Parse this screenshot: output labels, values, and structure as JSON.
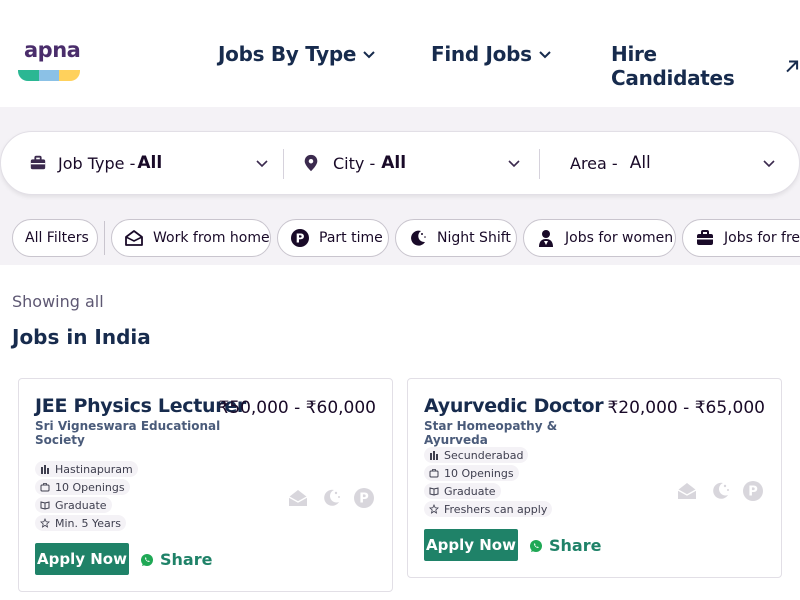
{
  "brand": {
    "name": "apna",
    "bar_colors": [
      "#2bb793",
      "#8bc1e6",
      "#ffd15c"
    ]
  },
  "nav": {
    "items": [
      {
        "label": "Jobs By Type",
        "icon": "chevron-down-icon"
      },
      {
        "label": "Find Jobs",
        "icon": "chevron-down-icon"
      },
      {
        "label": "Hire Candidates",
        "icon": "arrow-up-right-icon"
      }
    ]
  },
  "search": {
    "job_type": {
      "label": "Job Type -",
      "value": "All"
    },
    "city": {
      "label": "City -",
      "value": "All"
    },
    "area": {
      "label": "Area -",
      "value": "All"
    }
  },
  "filters": [
    {
      "label": "All Filters"
    },
    {
      "label": "Work from home",
      "icon": "home-icon"
    },
    {
      "label": "Part time",
      "icon": "part-time-icon"
    },
    {
      "label": "Night Shift",
      "icon": "moon-icon"
    },
    {
      "label": "Jobs for women",
      "icon": "woman-icon"
    },
    {
      "label": "Jobs for freshers",
      "icon": "briefcase-icon"
    }
  ],
  "results": {
    "showing_text": "Showing all",
    "heading": "Jobs in India"
  },
  "jobs": [
    {
      "title": "JEE Physics Lecturer",
      "company": "Sri Vigneswara Educational Society",
      "salary": "₹50,000 - ₹60,000",
      "tags": [
        {
          "text": "Hastinapuram",
          "icon": "building-icon"
        },
        {
          "text": "10 Openings",
          "icon": "briefcase-icon"
        },
        {
          "text": "Graduate",
          "icon": "education-icon"
        },
        {
          "text": "Min. 5 Years",
          "icon": "star-icon"
        }
      ],
      "apply_label": "Apply Now",
      "share_label": "Share"
    },
    {
      "title": "Ayurvedic Doctor",
      "company": "Star Homeopathy & Ayurveda",
      "salary": "₹20,000 - ₹65,000",
      "tags": [
        {
          "text": "Secunderabad",
          "icon": "building-icon"
        },
        {
          "text": "10 Openings",
          "icon": "briefcase-icon"
        },
        {
          "text": "Graduate",
          "icon": "education-icon"
        },
        {
          "text": "Freshers can apply",
          "icon": "star-icon"
        }
      ],
      "apply_label": "Apply Now",
      "share_label": "Share"
    }
  ],
  "colors": {
    "navy": "#172b4d",
    "green": "#1f8268",
    "band": "#f4f2f6"
  }
}
